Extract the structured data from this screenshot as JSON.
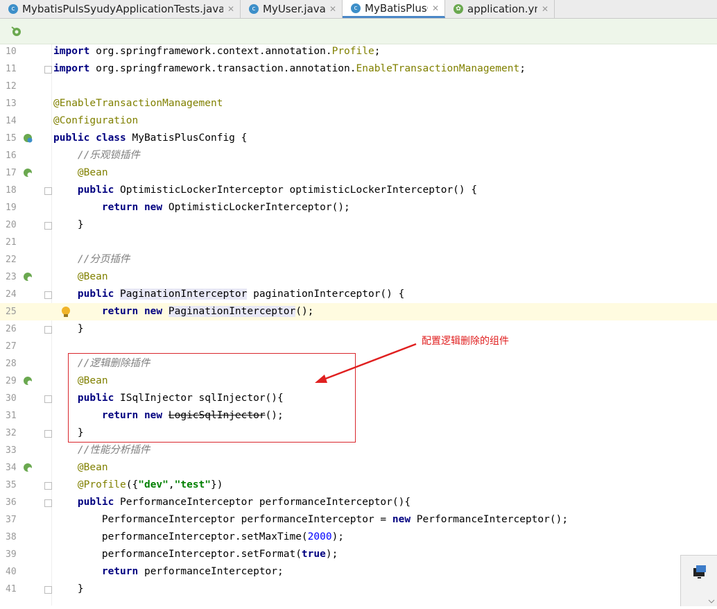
{
  "tabs": [
    {
      "label": "MybatisPulsSyudyApplicationTests.java",
      "icon": "class-icon",
      "active": false
    },
    {
      "label": "MyUser.java",
      "icon": "class-icon",
      "active": false
    },
    {
      "label": "MyBatisPlusConfig.java",
      "icon": "class-icon",
      "active": true
    },
    {
      "label": "application.yml",
      "icon": "spring-yml-icon",
      "active": false
    }
  ],
  "annotation": {
    "callout": "配置逻辑删除的组件"
  },
  "lines": [
    {
      "n": "10",
      "tokens": [
        {
          "t": "import",
          "c": "kw"
        },
        {
          "t": " org.springframework.context.annotation."
        },
        {
          "t": "Profile",
          "c": "ann"
        },
        {
          "t": ";"
        }
      ]
    },
    {
      "n": "11",
      "tokens": [
        {
          "t": "import",
          "c": "kw"
        },
        {
          "t": " org.springframework.transaction.annotation."
        },
        {
          "t": "EnableTransactionManagement",
          "c": "ann"
        },
        {
          "t": ";"
        }
      ]
    },
    {
      "n": "12",
      "tokens": []
    },
    {
      "n": "13",
      "tokens": [
        {
          "t": "@EnableTransactionManagement",
          "c": "ann"
        }
      ]
    },
    {
      "n": "14",
      "tokens": [
        {
          "t": "@Configuration",
          "c": "ann"
        }
      ]
    },
    {
      "n": "15",
      "tokens": [
        {
          "t": "public class",
          "c": "kw"
        },
        {
          "t": " MyBatisPlusConfig {"
        }
      ]
    },
    {
      "n": "16",
      "tokens": [
        {
          "t": "    "
        },
        {
          "t": "//乐观锁插件",
          "c": "cm"
        }
      ]
    },
    {
      "n": "17",
      "tokens": [
        {
          "t": "    "
        },
        {
          "t": "@Bean",
          "c": "ann"
        }
      ]
    },
    {
      "n": "18",
      "tokens": [
        {
          "t": "    "
        },
        {
          "t": "public",
          "c": "kw"
        },
        {
          "t": " OptimisticLockerInterceptor optimisticLockerInterceptor() {"
        }
      ]
    },
    {
      "n": "19",
      "tokens": [
        {
          "t": "        "
        },
        {
          "t": "return new",
          "c": "kw"
        },
        {
          "t": " OptimisticLockerInterceptor();"
        }
      ]
    },
    {
      "n": "20",
      "tokens": [
        {
          "t": "    }"
        }
      ]
    },
    {
      "n": "21",
      "tokens": []
    },
    {
      "n": "22",
      "tokens": [
        {
          "t": "    "
        },
        {
          "t": "//分页插件",
          "c": "cm"
        }
      ]
    },
    {
      "n": "23",
      "tokens": [
        {
          "t": "    "
        },
        {
          "t": "@Bean",
          "c": "ann"
        }
      ]
    },
    {
      "n": "24",
      "tokens": [
        {
          "t": "    "
        },
        {
          "t": "public",
          "c": "kw"
        },
        {
          "t": " "
        },
        {
          "t": "PaginationInterceptor",
          "c": "hltype"
        },
        {
          "t": " paginationInterceptor() {"
        }
      ]
    },
    {
      "n": "25",
      "tokens": [
        {
          "t": "        "
        },
        {
          "t": "return new",
          "c": "kw"
        },
        {
          "t": " "
        },
        {
          "t": "PaginationInterceptor",
          "c": "hltype"
        },
        {
          "t": "();"
        }
      ]
    },
    {
      "n": "26",
      "tokens": [
        {
          "t": "    }"
        }
      ]
    },
    {
      "n": "27",
      "tokens": []
    },
    {
      "n": "28",
      "tokens": [
        {
          "t": "    "
        },
        {
          "t": "//逻辑删除插件",
          "c": "cm"
        }
      ]
    },
    {
      "n": "29",
      "tokens": [
        {
          "t": "    "
        },
        {
          "t": "@Bean",
          "c": "ann"
        }
      ]
    },
    {
      "n": "30",
      "tokens": [
        {
          "t": "    "
        },
        {
          "t": "public",
          "c": "kw"
        },
        {
          "t": " ISqlInjector sqlInjector(){"
        }
      ]
    },
    {
      "n": "31",
      "tokens": [
        {
          "t": "        "
        },
        {
          "t": "return new",
          "c": "kw"
        },
        {
          "t": " "
        },
        {
          "t": "LogicSqlInjector",
          "c": "strike"
        },
        {
          "t": "();"
        }
      ]
    },
    {
      "n": "32",
      "tokens": [
        {
          "t": "    }"
        }
      ]
    },
    {
      "n": "33",
      "tokens": [
        {
          "t": "    "
        },
        {
          "t": "//性能分析插件",
          "c": "cm"
        }
      ]
    },
    {
      "n": "34",
      "tokens": [
        {
          "t": "    "
        },
        {
          "t": "@Bean",
          "c": "ann"
        }
      ]
    },
    {
      "n": "35",
      "tokens": [
        {
          "t": "    "
        },
        {
          "t": "@Profile",
          "c": "ann"
        },
        {
          "t": "({"
        },
        {
          "t": "\"dev\"",
          "c": "str"
        },
        {
          "t": ","
        },
        {
          "t": "\"test\"",
          "c": "str"
        },
        {
          "t": "})"
        }
      ]
    },
    {
      "n": "36",
      "tokens": [
        {
          "t": "    "
        },
        {
          "t": "public",
          "c": "kw"
        },
        {
          "t": " PerformanceInterceptor performanceInterceptor(){"
        }
      ]
    },
    {
      "n": "37",
      "tokens": [
        {
          "t": "        PerformanceInterceptor performanceInterceptor = "
        },
        {
          "t": "new",
          "c": "kw"
        },
        {
          "t": " PerformanceInterceptor();"
        }
      ]
    },
    {
      "n": "38",
      "tokens": [
        {
          "t": "        performanceInterceptor.setMaxTime("
        },
        {
          "t": "2000",
          "c": "num"
        },
        {
          "t": ");"
        }
      ]
    },
    {
      "n": "39",
      "tokens": [
        {
          "t": "        performanceInterceptor.setFormat("
        },
        {
          "t": "true",
          "c": "kw"
        },
        {
          "t": ");"
        }
      ]
    },
    {
      "n": "40",
      "tokens": [
        {
          "t": "        "
        },
        {
          "t": "return",
          "c": "kw"
        },
        {
          "t": " performanceInterceptor;"
        }
      ]
    },
    {
      "n": "41",
      "tokens": [
        {
          "t": "    }"
        }
      ]
    }
  ],
  "gutter_marks": {
    "15": "spring-bean-config-icon",
    "17": "spring-bean-icon",
    "23": "spring-bean-icon",
    "29": "spring-bean-icon",
    "34": "spring-bean-icon"
  },
  "fold_lines": [
    "11",
    "18",
    "20",
    "24",
    "26",
    "30",
    "32",
    "35",
    "36",
    "41"
  ],
  "highlight_line": "25",
  "bulb_line": "25",
  "colors": {
    "keyword": "#000080",
    "annotation": "#808000",
    "comment": "#808080",
    "string": "#008000",
    "number": "#0000ff",
    "callout": "#e02020"
  }
}
